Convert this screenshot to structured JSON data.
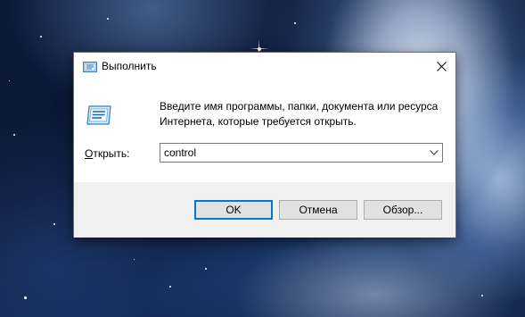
{
  "window": {
    "title": "Выполнить",
    "title_icon": "run-icon",
    "close_icon": "close-icon"
  },
  "description": {
    "line1": "Введите имя программы, папки, документа или ресурса",
    "line2": "Интернета, которые требуется открыть."
  },
  "open_field": {
    "label_accel": "О",
    "label_rest": "ткрыть:",
    "value": "control",
    "dropdown_icon": "chevron-down-icon"
  },
  "buttons": {
    "ok": "OK",
    "cancel": "Отмена",
    "browse": "Обзор..."
  },
  "colors": {
    "accent": "#0078d7",
    "footer_bg": "#f0f0f0",
    "button_bg": "#e1e1e1"
  }
}
